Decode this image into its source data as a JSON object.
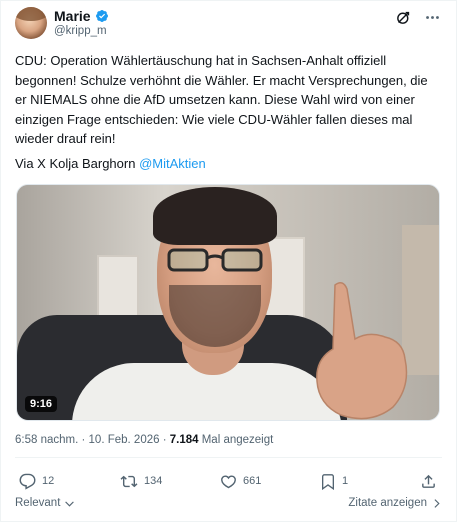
{
  "author": {
    "name": "Marie",
    "handle": "@kripp_m",
    "verified": true
  },
  "tweet": {
    "text": "CDU: Operation Wählertäuschung hat in Sachsen-Anhalt offiziell begonnen! Schulze verhöhnt die Wähler. Er macht Versprechungen, die er NIEMALS ohne die AfD umsetzen kann. Diese Wahl wird von einer einzigen Frage entschieden: Wie viele CDU-Wähler fallen dieses mal wieder drauf rein!",
    "via_prefix": "Via X Kolja Barghorn ",
    "via_mention": "@MitAktien"
  },
  "media": {
    "duration": "9:16"
  },
  "meta": {
    "time": "6:58 nachm.",
    "separator": " · ",
    "date": "10. Feb. 2026",
    "views_count": "7.184",
    "views_label": " Mal angezeigt"
  },
  "actions": {
    "replies": "12",
    "reposts": "134",
    "likes": "661",
    "bookmarks": "1"
  },
  "footer": {
    "sort_label": "Relevant",
    "quotes_label": "Zitate anzeigen"
  },
  "colors": {
    "accent": "#1d9bf0",
    "text": "#0f1419",
    "muted": "#536471"
  },
  "icons": [
    "verified-badge-icon",
    "grok-icon",
    "more-icon",
    "reply-icon",
    "repost-icon",
    "like-icon",
    "bookmark-icon",
    "share-icon",
    "chevron-down-icon",
    "chevron-right-icon"
  ]
}
